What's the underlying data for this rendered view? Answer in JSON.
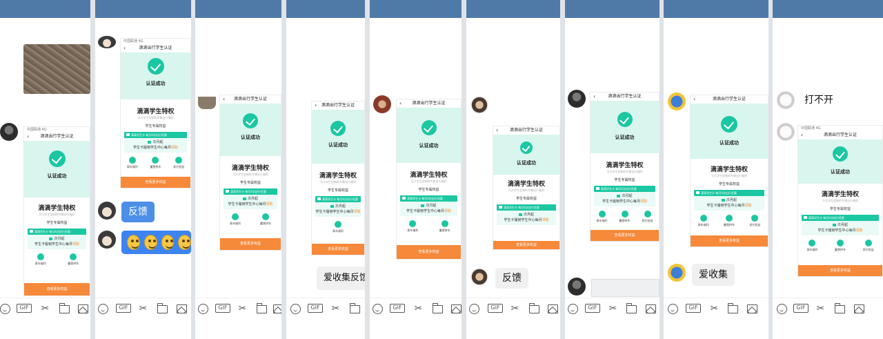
{
  "screens": {
    "status_text": "中国联通 4G",
    "page_title": "滴滴出行学生认证",
    "hero_text": "认证成功",
    "privilege_title": "滴滴学生特权",
    "privilege_subtitle": "为大学生定制的专属出行福利",
    "exclusive_label": "学生专属权益",
    "card_header": "滴滴学生卡 每月4次出行优惠",
    "card_line1": "次月起",
    "card_line2_prefix": "学生卡履韧学生中心每月",
    "card_line2_highlight": "领取",
    "icon_labels": [
      "乘车福利",
      "叢营拼车",
      "其它权益"
    ],
    "cta_label": "查看更多权益"
  },
  "chat": {
    "feedback": "反馈",
    "collect_feedback": "爱收集反馈",
    "collect": "爱收集",
    "cannot_open": "打不开"
  },
  "toolbar": {
    "gif_label": "GIF"
  },
  "colors": {
    "accent": "#1bc7a2",
    "cta": "#f6893a",
    "topbar": "#4f7aa8",
    "blue_bubble": "#4b8fe8"
  }
}
